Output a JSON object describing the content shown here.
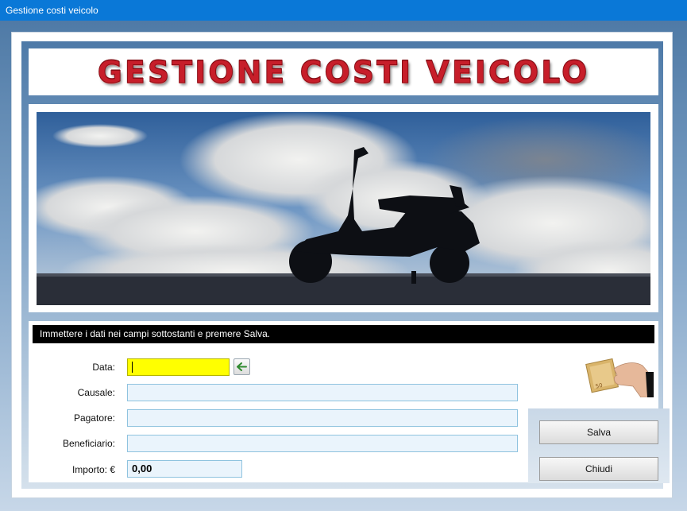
{
  "window": {
    "title": "Gestione costi veicolo"
  },
  "banner": {
    "title": "GESTIONE COSTI VEICOLO"
  },
  "form": {
    "instruction": "Immettere i dati nei campi sottostanti e premere Salva.",
    "fields": {
      "data": {
        "label": "Data:",
        "value": ""
      },
      "causale": {
        "label": "Causale:",
        "value": ""
      },
      "pagatore": {
        "label": "Pagatore:",
        "value": ""
      },
      "beneficiario": {
        "label": "Beneficiario:",
        "value": ""
      },
      "importo": {
        "label": "Importo: €",
        "value": "0,00"
      }
    }
  },
  "buttons": {
    "save": "Salva",
    "close": "Chiudi"
  },
  "icons": {
    "date_button": "arrow-left-icon",
    "money": "euro-banknote-hand-icon"
  },
  "colors": {
    "titlebar": "#0a78d7",
    "banner_text": "#c71e2a",
    "required_field": "#ffff00",
    "field_bg": "#eaf4fc"
  }
}
